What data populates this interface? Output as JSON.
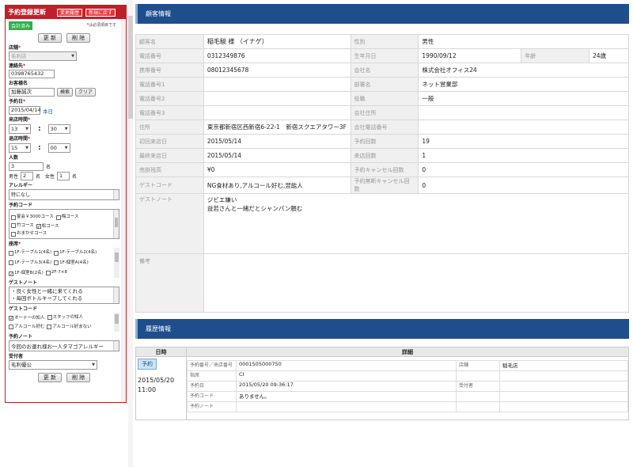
{
  "left_panel": {
    "title": "予約登録更新",
    "header_buttons": [
      "変更履歴",
      "新規に戻す"
    ],
    "status_badge": "会計済み",
    "required_note": "*は必須項目です",
    "top_buttons": [
      "更 新",
      "削 除"
    ],
    "store_label": "店舗",
    "store_value": "毛利店",
    "phone_label": "連絡先",
    "phone_value": "0398765432",
    "name_label": "お客様名",
    "name_value": "加藤誠次",
    "search_btn": "検索",
    "clear_btn": "クリア",
    "date_label": "予約日",
    "date_value": "2015/04/14",
    "today_link": "本日",
    "arrive_label": "来店時間",
    "arrive_hour": "13",
    "arrive_min": "30",
    "leave_label": "退店時間",
    "leave_hour": "15",
    "leave_min": "00",
    "colon": ":",
    "people_label": "人数",
    "people_value": "3",
    "people_unit": "名",
    "male_label": "男性",
    "male_value": "2",
    "female_label": "女性",
    "female_value": "1",
    "allergy_label": "アレルギー",
    "allergy_value": "特になし",
    "course_label": "予約コード",
    "courses": [
      {
        "label": "宴会￥3000コース",
        "checked": false
      },
      {
        "label": "梅コース",
        "checked": false
      },
      {
        "label": "竹コース",
        "checked": false
      },
      {
        "label": "松コース",
        "checked": true
      },
      {
        "label": "おまかせコース",
        "checked": false
      }
    ],
    "seat_label": "座席",
    "seats": [
      {
        "label": "1F-テーブル1(4名)",
        "checked": false
      },
      {
        "label": "1F-テーブル2(4名)",
        "checked": false
      },
      {
        "label": "1F-テーブル3(4名)",
        "checked": false
      },
      {
        "label": "1F-個室A(4名)",
        "checked": false
      },
      {
        "label": "1F-個室B(2名)",
        "checked": true
      },
      {
        "label": "2F-7×8",
        "checked": false
      }
    ],
    "guestnote_label": "ゲストノート",
    "guestnote_lines": [
      "・良く女性と一緒に来てくれる",
      "・毎回ボトルキープしてくれる"
    ],
    "guestcode_label": "ゲストコード",
    "guestcodes": [
      {
        "label": "オーナーの知人",
        "checked": true
      },
      {
        "label": "スタッフの知人",
        "checked": false
      },
      {
        "label": "アルコール好む",
        "checked": false
      },
      {
        "label": "アルコール好まない",
        "checked": false
      }
    ],
    "resnote_label": "予約ノート",
    "resnote_value": "今回のお連れ様お一人タマゴアレルギー",
    "receiver_label": "受付者",
    "receiver_value": "毛利優公",
    "bottom_buttons": [
      "更 新",
      "削 除"
    ]
  },
  "customer": {
    "title": "顧客情報",
    "rows": [
      [
        {
          "k": "顧客名"
        },
        {
          "v": "稲毛駿 様 （イナゲ）",
          "w": "name"
        },
        {
          "k": "性別"
        },
        {
          "v": "男性",
          "span": 3
        }
      ],
      [
        {
          "k": "電話番号"
        },
        {
          "v": "0312349876"
        },
        {
          "k": "生年月日"
        },
        {
          "v": "1990/09/12"
        },
        {
          "k": "年齢"
        },
        {
          "v": "24歳"
        }
      ],
      [
        {
          "k": "携帯番号"
        },
        {
          "v": "08012345678"
        },
        {
          "k": "会社名"
        },
        {
          "v": "株式会社オフィス24",
          "span": 3
        }
      ],
      [
        {
          "k": "電話番号1"
        },
        {
          "v": ""
        },
        {
          "k": "部署名"
        },
        {
          "v": "ネット営業部",
          "span": 3
        }
      ],
      [
        {
          "k": "電話番号2"
        },
        {
          "v": ""
        },
        {
          "k": "役職"
        },
        {
          "v": "一般",
          "span": 3
        }
      ],
      [
        {
          "k": "電話番号3"
        },
        {
          "v": ""
        },
        {
          "k": "会社住所"
        },
        {
          "v": "",
          "span": 3
        }
      ],
      [
        {
          "k": "住所"
        },
        {
          "v": "東京都新宿区西新宿6-22-1　新宿スクエアタワー3F"
        },
        {
          "k": "会社電話番号"
        },
        {
          "v": "",
          "span": 3
        }
      ],
      [
        {
          "k": "初回来店日"
        },
        {
          "v": "2015/05/14"
        },
        {
          "k": "予約回数"
        },
        {
          "v": "19",
          "span": 3
        }
      ],
      [
        {
          "k": "最終来店日"
        },
        {
          "v": "2015/05/14"
        },
        {
          "k": "来店回数"
        },
        {
          "v": "1",
          "span": 3
        }
      ],
      [
        {
          "k": "売掛残高"
        },
        {
          "v": "¥0"
        },
        {
          "k": "予約キャンセル回数"
        },
        {
          "v": "0",
          "span": 3
        }
      ],
      [
        {
          "k": "ゲストコード"
        },
        {
          "v": "NG食材あり,アルコール好む,翌能人"
        },
        {
          "k": "予約無断キャンセル回数"
        },
        {
          "v": "0",
          "span": 3
        }
      ]
    ],
    "guestnote_label": "ゲストノート",
    "guestnote_lines": [
      "ジビエ嫌い",
      "益若さんと一緒だとシャンパン頼む"
    ],
    "memo_label": "備考"
  },
  "history": {
    "title": "履歴情報",
    "col_date": "日時",
    "col_detail": "詳細",
    "tag": "予約",
    "date": "2015/05/20",
    "time": "11:00",
    "fields": [
      {
        "k": "予約番号／来店番号",
        "v": "0001505000750",
        "k2": "店舗",
        "v2": "稲毛店"
      },
      {
        "k": "指席",
        "v": "CI",
        "k2": "",
        "v2": ""
      },
      {
        "k": "予約日",
        "v": "2015/05/20 09:36:17",
        "k2": "受付者",
        "v2": ""
      },
      {
        "k": "予約コード",
        "v": "ありません。",
        "k2": "",
        "v2": ""
      },
      {
        "k": "予約ノート",
        "v": "",
        "k2": "",
        "v2": ""
      }
    ]
  }
}
